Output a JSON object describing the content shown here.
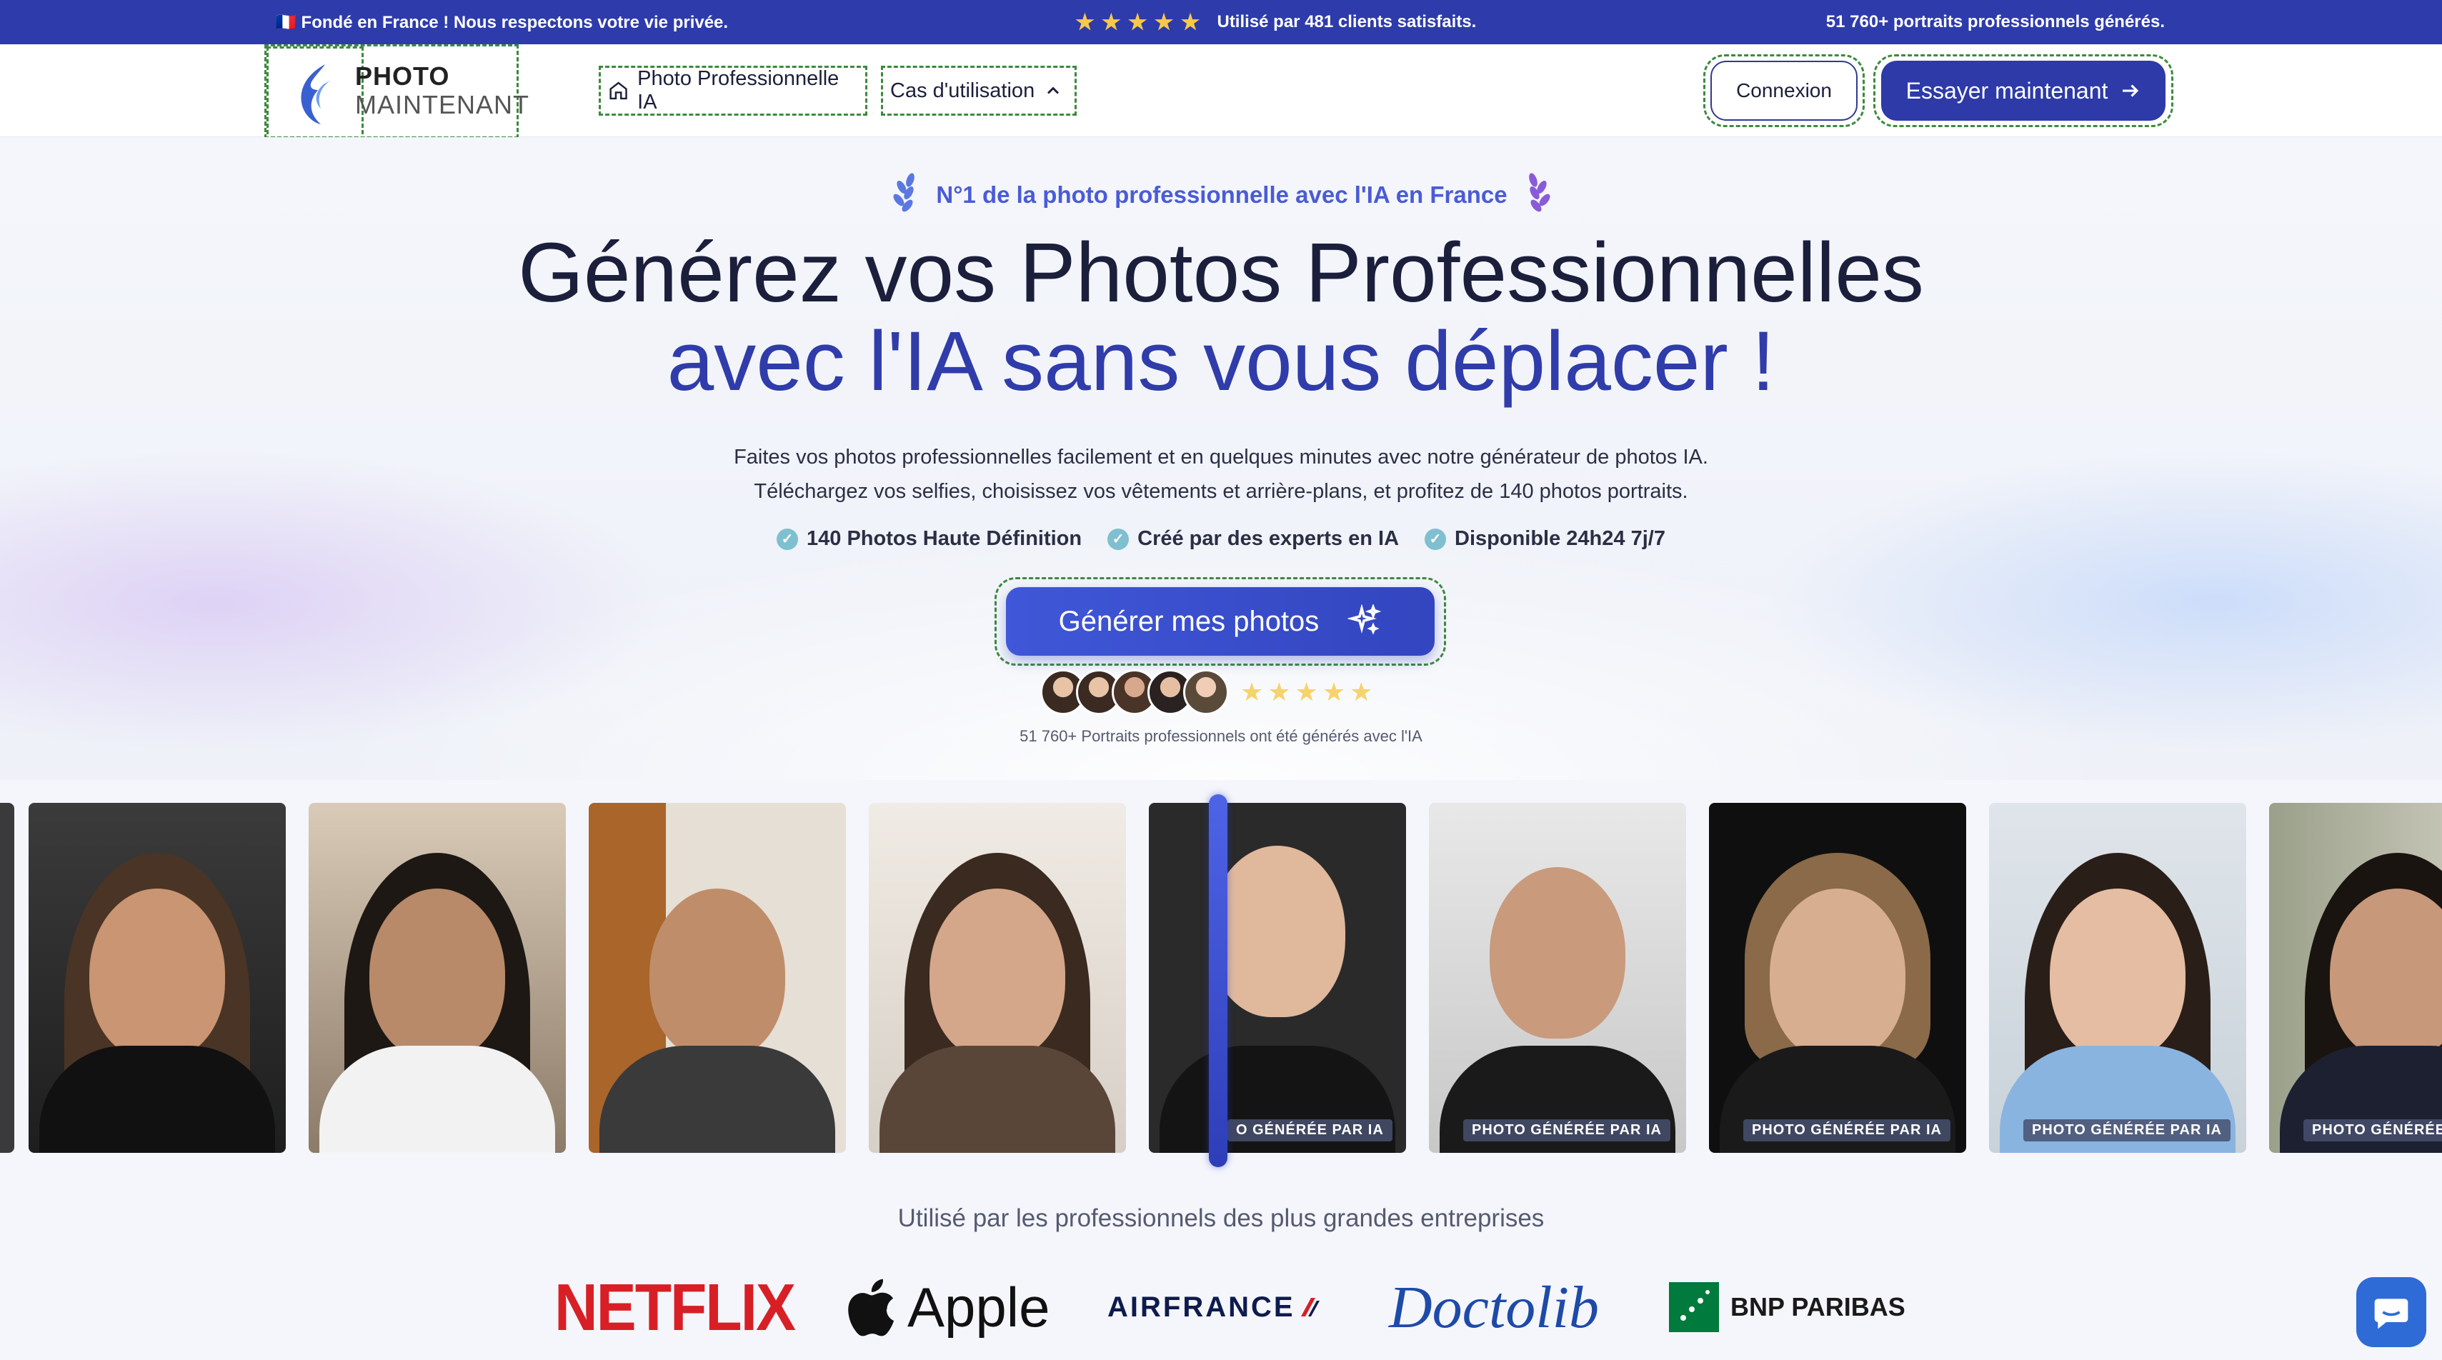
{
  "topbar": {
    "left": "🇫🇷 Fondé en France ! Nous respectons votre vie privée.",
    "stars": "★★★★★",
    "center": "Utilisé par 481 clients satisfaits.",
    "right": "51 760+ portraits professionnels générés."
  },
  "header": {
    "logo_line1": "PHOTO",
    "logo_line2": "MAINTENANT",
    "nav": [
      {
        "label": "Photo Professionnelle IA",
        "icon": "home-icon"
      },
      {
        "label": "Cas d'utilisation",
        "icon": "chevron-up-icon"
      }
    ],
    "login_label": "Connexion",
    "try_label": "Essayer maintenant"
  },
  "hero": {
    "badge": "N°1 de la photo professionnelle avec l'IA en France",
    "title_line1": "Générez vos Photos Professionnelles",
    "title_line2": "avec l'IA sans vous déplacer !",
    "subtitle_line1": "Faites vos photos professionnelles facilement et en quelques minutes avec notre générateur de photos IA.",
    "subtitle_line2": "Téléchargez vos selfies, choisissez vos vêtements et arrière-plans, et profitez de 140 photos portraits.",
    "features": [
      "140 Photos Haute Définition",
      "Créé par des experts en IA",
      "Disponible 24h24 7j/7"
    ],
    "cta_label": "Générer mes photos",
    "rating_stars": "★★★★★",
    "social_text": "51 760+ Portraits professionnels ont été générés avec l'IA"
  },
  "gallery": {
    "label": "PHOTO GÉNÉRÉE PAR IA",
    "label_partial": "O GÉNÉRÉE PAR IA",
    "label_cut": "PHOTO GÉNÉRÉE P"
  },
  "trusted": {
    "heading": "Utilisé par les professionnels des plus grandes entreprises",
    "logos": [
      "NETFLIX",
      "Apple",
      "AIRFRANCE",
      "Doctolib",
      "BNP PARIBAS"
    ]
  },
  "colors": {
    "brand": "#2e3bab",
    "accent": "#4a5bd8",
    "star": "#f6c948"
  }
}
